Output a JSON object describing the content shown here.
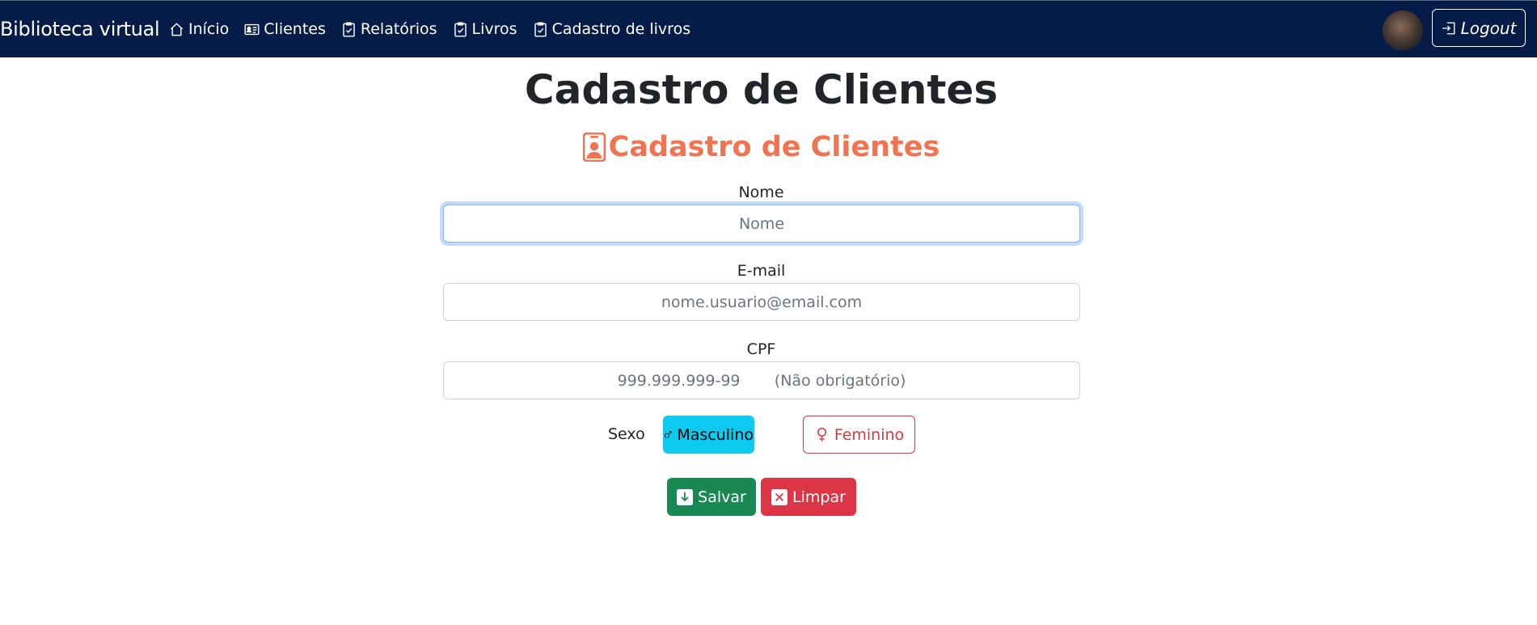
{
  "navbar": {
    "brand": "Biblioteca virtual",
    "links": [
      {
        "label": "Início",
        "icon": "house-icon"
      },
      {
        "label": "Clientes",
        "icon": "person-card-icon"
      },
      {
        "label": "Relatórios",
        "icon": "clipboard-check-icon"
      },
      {
        "label": "Livros",
        "icon": "clipboard-check-icon"
      },
      {
        "label": "Cadastro de livros",
        "icon": "clipboard-check-icon"
      }
    ],
    "logout_label": "Logout"
  },
  "page": {
    "title": "Cadastro de Clientes",
    "form_title": "Cadastro de Clientes"
  },
  "form": {
    "nome": {
      "label": "Nome",
      "placeholder": "Nome",
      "value": ""
    },
    "email": {
      "label": "E-mail",
      "placeholder": "nome.usuario@email.com",
      "value": ""
    },
    "cpf": {
      "label": "CPF",
      "placeholder": "999.999.999-99       (Não obrigatório)",
      "value": ""
    },
    "sexo": {
      "label": "Sexo",
      "options": [
        {
          "label": "Masculino",
          "icon": "male-symbol-icon",
          "selected": true
        },
        {
          "label": "Feminino",
          "icon": "female-symbol-icon",
          "selected": false
        }
      ]
    },
    "save_label": "Salvar",
    "clear_label": "Limpar"
  },
  "colors": {
    "navbar": "#041c47",
    "form_title": "#f37350",
    "masculino": "#0dcaf0",
    "feminino": "#dc3545",
    "salvar": "#198754",
    "limpar": "#dc3545"
  }
}
